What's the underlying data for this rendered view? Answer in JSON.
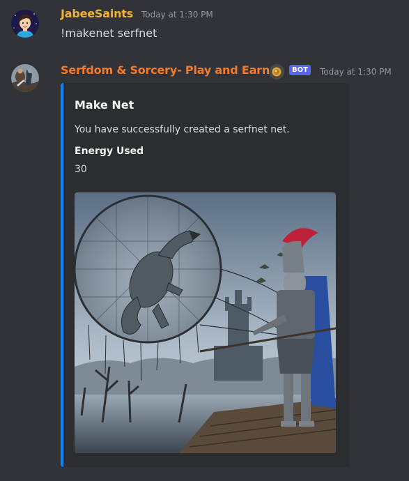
{
  "messages": [
    {
      "username": "JabeeSaints",
      "timestamp": "Today at 1:30 PM",
      "content": "!makenet serfnet",
      "avatar_icon": "cartoon-man-avatar-icon",
      "name_color": "#f0b232"
    },
    {
      "username": "Serfdom & Sorcery- Play and Earn",
      "timestamp": "Today at 1:30 PM",
      "bot_tag": "BOT",
      "avatar_icon": "knight-battle-avatar-icon",
      "name_color": "#f47b2a",
      "embed": {
        "accent_color": "#0a84ff",
        "title": "Make Net",
        "description": "You have successfully created a serfnet net.",
        "fields": [
          {
            "name": "Energy Used",
            "value": "30"
          }
        ],
        "image": "knight-with-net-capturing-dinosaur-image"
      }
    }
  ]
}
